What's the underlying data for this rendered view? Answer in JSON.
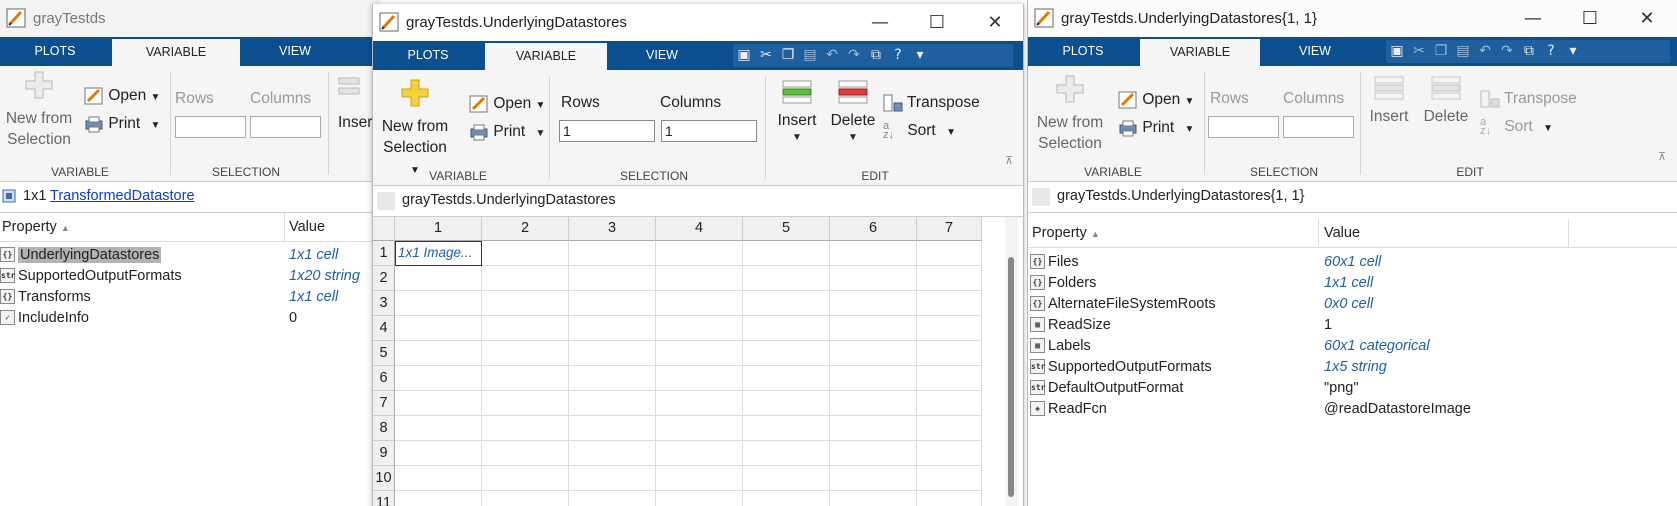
{
  "window1": {
    "title": "grayTestds",
    "tabs": [
      "PLOTS",
      "VARIABLE",
      "VIEW"
    ],
    "ribbon": {
      "new_from_selection": [
        "New from",
        "Selection"
      ],
      "open": "Open",
      "print": "Print",
      "rows_label": "Rows",
      "columns_label": "Columns",
      "insert": "Insert",
      "group_variable": "VARIABLE",
      "group_selection": "SELECTION"
    },
    "address": {
      "size": "1x1",
      "class_link": "TransformedDatastore"
    },
    "table_header": {
      "property": "Property",
      "sort_glyph": "▲",
      "value": "Value"
    },
    "properties": [
      {
        "icon": "cell-icon",
        "icon_text": "{}",
        "name": "UnderlyingDatastores",
        "value": "1x1 cell",
        "italic": true,
        "selected": true
      },
      {
        "icon": "string-icon",
        "icon_text": "str",
        "name": "SupportedOutputFormats",
        "value": "1x20 string",
        "italic": true
      },
      {
        "icon": "cell-icon",
        "icon_text": "{}",
        "name": "Transforms",
        "value": "1x1 cell",
        "italic": true
      },
      {
        "icon": "logical-check-icon",
        "icon_text": "✓",
        "name": "IncludeInfo",
        "value": "0",
        "italic": false
      }
    ]
  },
  "window2": {
    "title": "grayTestds.UnderlyingDatastores",
    "tabs": [
      "PLOTS",
      "VARIABLE",
      "VIEW"
    ],
    "ribbon": {
      "new_from_selection": [
        "New from",
        "Selection"
      ],
      "open": "Open",
      "print": "Print",
      "rows_label": "Rows",
      "rows_value": "1",
      "columns_label": "Columns",
      "columns_value": "1",
      "insert": "Insert",
      "delete": "Delete",
      "transpose": "Transpose",
      "sort": "Sort",
      "group_variable": "VARIABLE",
      "group_selection": "SELECTION",
      "group_edit": "EDIT"
    },
    "address": "grayTestds.UnderlyingDatastores",
    "columns": [
      "1",
      "2",
      "3",
      "4",
      "5",
      "6",
      "7"
    ],
    "rows": [
      "1",
      "2",
      "3",
      "4",
      "5",
      "6",
      "7",
      "8",
      "9",
      "10",
      "11"
    ],
    "cell_1_1": "1x1 Image..."
  },
  "window3": {
    "title": "grayTestds.UnderlyingDatastores{1, 1}",
    "tabs": [
      "PLOTS",
      "VARIABLE",
      "VIEW"
    ],
    "ribbon": {
      "new_from_selection": [
        "New from",
        "Selection"
      ],
      "open": "Open",
      "print": "Print",
      "rows_label": "Rows",
      "columns_label": "Columns",
      "insert": "Insert",
      "delete": "Delete",
      "transpose": "Transpose",
      "sort": "Sort",
      "group_variable": "VARIABLE",
      "group_selection": "SELECTION",
      "group_edit": "EDIT"
    },
    "address": "grayTestds.UnderlyingDatastores{1, 1}",
    "table_header": {
      "property": "Property",
      "sort_glyph": "▲",
      "value": "Value"
    },
    "properties": [
      {
        "icon": "cell-icon",
        "icon_text": "{}",
        "name": "Files",
        "value": "60x1 cell",
        "italic": true
      },
      {
        "icon": "cell-icon",
        "icon_text": "{}",
        "name": "Folders",
        "value": "1x1 cell",
        "italic": true
      },
      {
        "icon": "cell-icon",
        "icon_text": "{}",
        "name": "AlternateFileSystemRoots",
        "value": "0x0 cell",
        "italic": true
      },
      {
        "icon": "matrix-icon",
        "icon_text": "▦",
        "name": "ReadSize",
        "value": "1",
        "italic": false
      },
      {
        "icon": "categorical-icon",
        "icon_text": "▦",
        "name": "Labels",
        "value": "60x1 categorical",
        "italic": true
      },
      {
        "icon": "string-icon",
        "icon_text": "str",
        "name": "SupportedOutputFormats",
        "value": "1x5 string",
        "italic": true
      },
      {
        "icon": "string-icon",
        "icon_text": "str",
        "name": "DefaultOutputFormat",
        "value": "\"png\"",
        "italic": false
      },
      {
        "icon": "function-handle-icon",
        "icon_text": "◈",
        "name": "ReadFcn",
        "value": "@readDatastoreImage",
        "italic": false
      }
    ]
  },
  "colors": {
    "tabstrip": "#0b4f8f",
    "link": "#0b3fc5",
    "italic_value": "#1d5fa8",
    "selection": "#b3b3b3"
  }
}
